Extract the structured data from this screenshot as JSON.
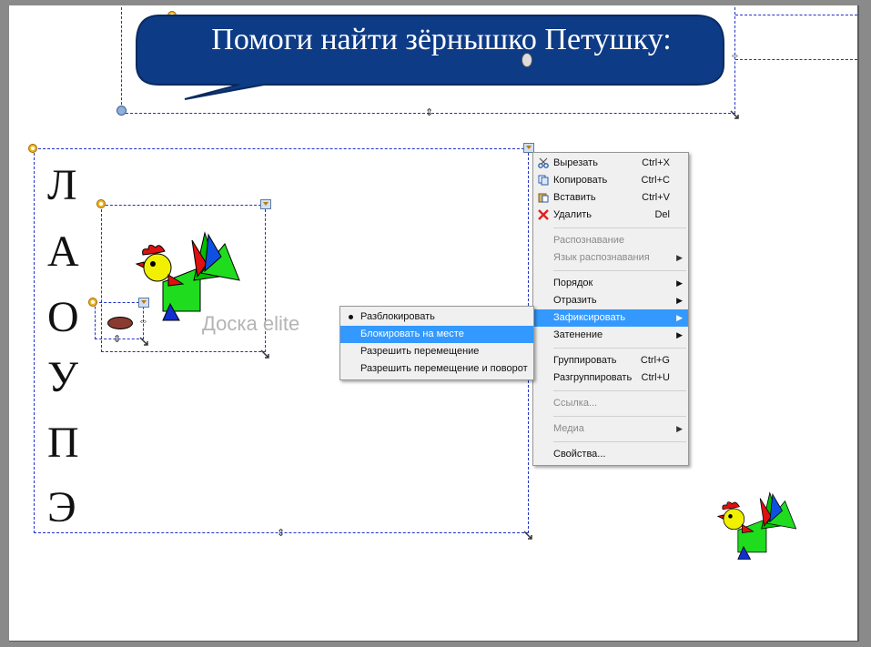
{
  "banner": {
    "title": "Помоги найти зёрнышко Петушку:"
  },
  "watermark": "Доска elite",
  "letters": [
    "Л",
    "А",
    "О",
    "У",
    "П",
    "Э"
  ],
  "context_menu": {
    "items": [
      {
        "label": "Вырезать",
        "shortcut": "Ctrl+X",
        "icon": "scissors-icon"
      },
      {
        "label": "Копировать",
        "shortcut": "Ctrl+C",
        "icon": "copy-icon"
      },
      {
        "label": "Вставить",
        "shortcut": "Ctrl+V",
        "icon": "paste-icon"
      },
      {
        "label": "Удалить",
        "shortcut": "Del",
        "icon": "delete-icon"
      },
      {
        "label": "Распознавание"
      },
      {
        "label": "Язык распознавания"
      },
      {
        "label": "Порядок"
      },
      {
        "label": "Отразить"
      },
      {
        "label": "Зафиксировать"
      },
      {
        "label": "Затенение"
      },
      {
        "label": "Группировать",
        "shortcut": "Ctrl+G"
      },
      {
        "label": "Разгруппировать",
        "shortcut": "Ctrl+U"
      },
      {
        "label": "Ссылка..."
      },
      {
        "label": "Медиа"
      },
      {
        "label": "Свойства..."
      }
    ]
  },
  "submenu": {
    "items": [
      {
        "label": "Разблокировать"
      },
      {
        "label": "Блокировать на месте"
      },
      {
        "label": "Разрешить перемещение"
      },
      {
        "label": "Разрешить перемещение и поворот"
      }
    ]
  },
  "colors": {
    "banner_fill": "#0d3b86",
    "highlight": "#3399ff",
    "selection": "#2030c8"
  }
}
